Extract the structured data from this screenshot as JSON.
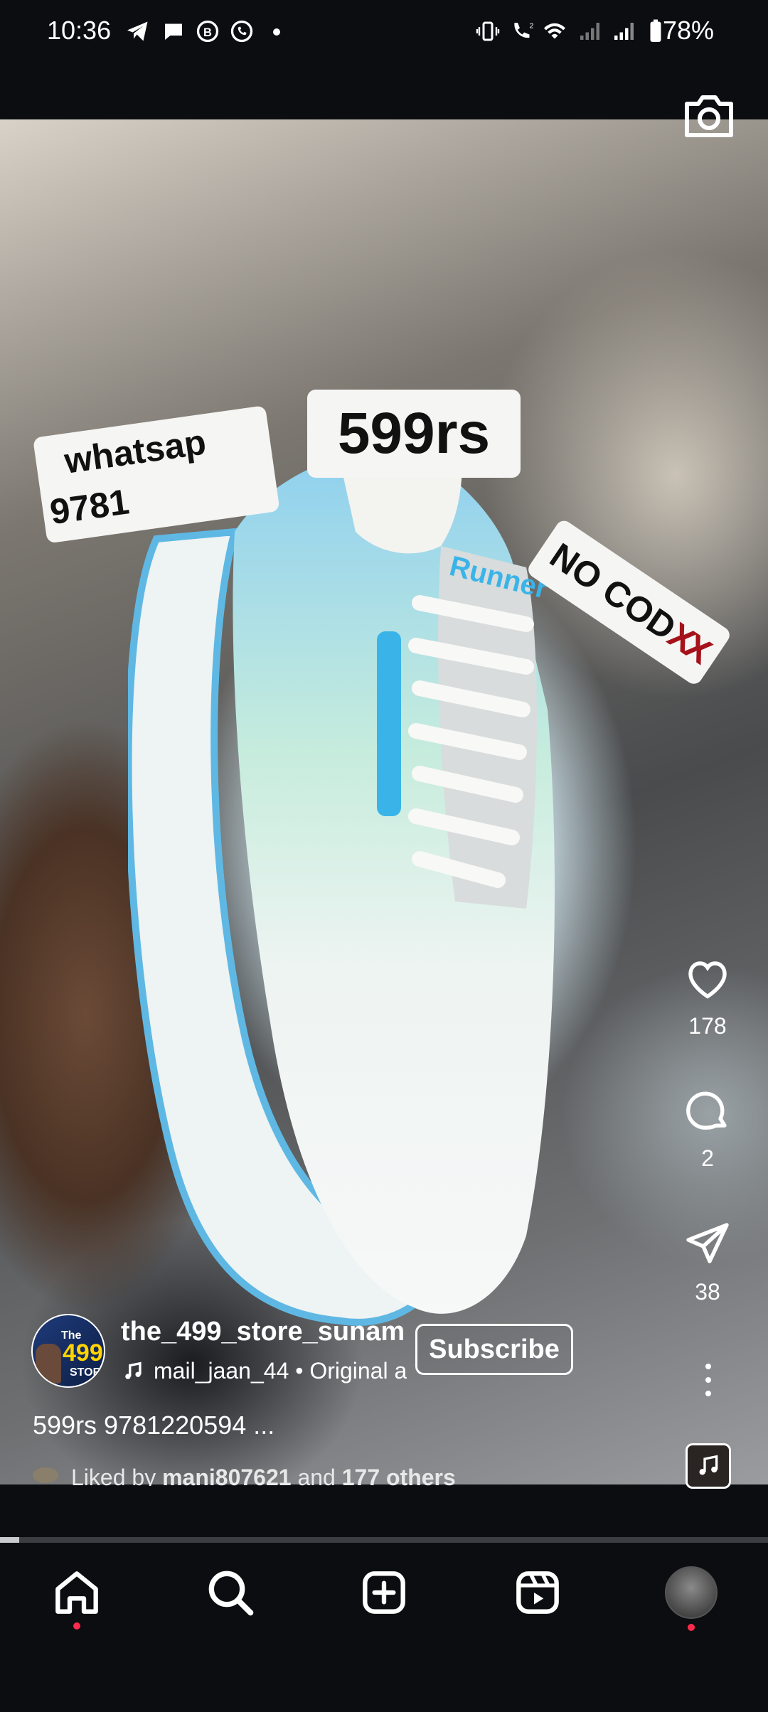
{
  "status_bar": {
    "time": "10:36",
    "battery": "78%"
  },
  "stickers": {
    "price": "599rs",
    "whatsapp_line1": "whatsap",
    "whatsapp_line2": "9781",
    "no_cod": "NO COD",
    "no_cod_marks": "XX"
  },
  "actions": {
    "likes": "178",
    "comments": "2",
    "shares": "38"
  },
  "post": {
    "username": "the_499_store_sunam",
    "subscribe_label": "Subscribe",
    "audio": "mail_jaan_44 • Original a",
    "caption": "599rs 9781220594 ...",
    "liked_prefix": "Liked by",
    "liked_user": "mani807621",
    "liked_mid": "and",
    "liked_count": "177 others",
    "avatar_text_top": "The",
    "avatar_text_num": "499",
    "avatar_text_bottom": "STORE"
  },
  "progress": 0.025,
  "colors": {
    "background": "#0b0d11",
    "notification_dot": "#ff2a4b",
    "shoe_accent": "#3ab4e8"
  },
  "icons": [
    "telegram-icon",
    "chat-icon",
    "bubble-icon",
    "whatsapp-icon",
    "vibrate-icon",
    "wifi-call-icon",
    "wifi-icon",
    "signal-icon",
    "battery-icon",
    "camera-icon",
    "heart-icon",
    "comment-icon",
    "share-icon",
    "more-icon",
    "music-icon",
    "home-icon",
    "search-icon",
    "create-icon",
    "reels-icon",
    "profile-icon"
  ]
}
